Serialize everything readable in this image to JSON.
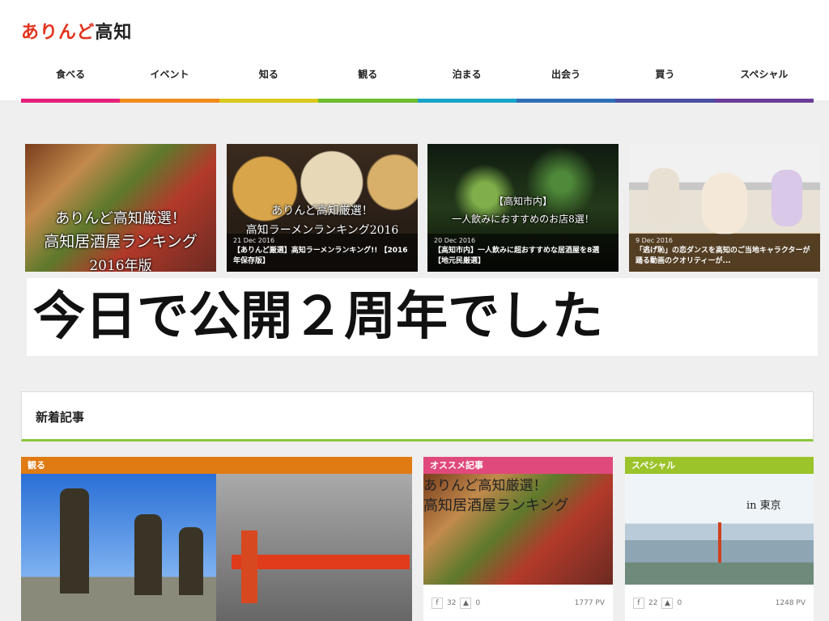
{
  "logo": {
    "part1": "ありんど",
    "part2": "高知"
  },
  "nav": [
    "食べる",
    "イベント",
    "知る",
    "観る",
    "泊まる",
    "出会う",
    "買う",
    "スペシャル"
  ],
  "rainbow_colors": [
    "#e5217a",
    "#f08a1d",
    "#d8c91a",
    "#6dbb2f",
    "#1aa3c9",
    "#2f6fb5",
    "#4b4fa3",
    "#6b3d98"
  ],
  "featured": [
    {
      "overlay_top": "ありんど高知厳選！",
      "overlay_mid": "高知居酒屋ランキング",
      "overlay_bot": "2016年版",
      "date": "",
      "title": ""
    },
    {
      "overlay_top": "ありんど高知厳選！",
      "overlay_mid": "高知ラーメンランキング2016",
      "overlay_bot": "",
      "date": "21 Dec 2016",
      "title": "【ありんど厳選】高知ラーメンランキング!! 【2016年保存版】"
    },
    {
      "overlay_top": "【高知市内】",
      "overlay_mid": "一人飲みにおすすめのお店8選！",
      "overlay_bot": "",
      "date": "20 Dec 2016",
      "title": "【高知市内】一人飲みに超おすすめな居酒屋を8選【地元民厳選】"
    },
    {
      "overlay_top": "",
      "overlay_mid": "",
      "overlay_bot": "",
      "date": "9 Dec 2016",
      "title": "「逃げ恥」の恋ダンスを高知のご当地キャラクターが踊る動画のクオリティーが..."
    }
  ],
  "banner": "今日で公開２周年でした",
  "new_articles": {
    "title": "新着記事"
  },
  "cards": [
    {
      "category": "観る",
      "color": "#e07b13",
      "likes": "",
      "shares": "",
      "pv": ""
    },
    {
      "category": "オススメ記事",
      "color": "#e0497c",
      "overlay_top": "ありんど高知厳選！",
      "overlay_mid": "高知居酒屋ランキング",
      "likes": "32",
      "shares": "0",
      "pv": "1777 PV"
    },
    {
      "category": "スペシャル",
      "color": "#9bc32a",
      "overlay_text": "in 東京",
      "likes": "22",
      "shares": "0",
      "pv": "1248 PV"
    }
  ],
  "icons": {
    "fb": "facebook-icon",
    "like": "thumbs-up-icon"
  }
}
